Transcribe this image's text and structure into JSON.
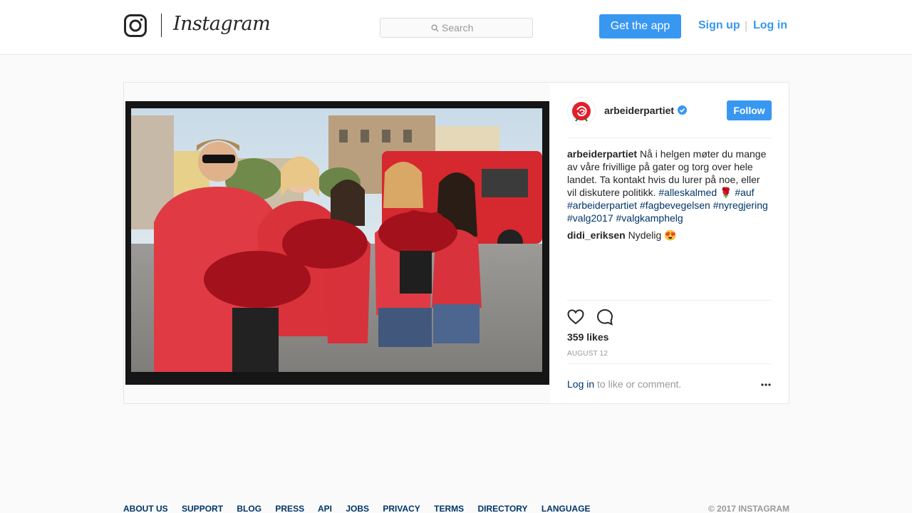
{
  "header": {
    "logo_text": "Instagram",
    "logo_icon": "instagram-camera-icon",
    "search": {
      "placeholder": "Search",
      "icon": "search-icon"
    },
    "get_app_label": "Get the app",
    "signup_label": "Sign up",
    "separator": "|",
    "login_label": "Log in"
  },
  "post": {
    "owner": "arbeiderpartiet",
    "verified_icon": "verified-badge-icon",
    "follow_label": "Follow",
    "caption": {
      "user": "arbeiderpartiet",
      "text": "Nå i helgen møter du mange av våre frivillige på gater og torg over hele landet. Ta kontakt hvis du lurer på noe, eller vil diskutere politikk.",
      "tag1": "#alleskalmed",
      "emoji": "🌹",
      "tags": [
        "#auf",
        "#arbeiderpartiet",
        "#fagbevegelsen",
        "#nyregjering",
        "#valg2017",
        "#valgkamphelg"
      ]
    },
    "comment": {
      "user": "didi_eriksen",
      "text": "Nydelig 😍"
    },
    "likes": "359 likes",
    "date": "AUGUST 12",
    "login_prompt": {
      "link": "Log in",
      "text": " to like or comment."
    }
  },
  "footer": {
    "links": [
      "ABOUT US",
      "SUPPORT",
      "BLOG",
      "PRESS",
      "API",
      "JOBS",
      "PRIVACY",
      "TERMS",
      "DIRECTORY",
      "LANGUAGE"
    ],
    "copyright": "© 2017 INSTAGRAM"
  },
  "colors": {
    "accent": "#3897f0",
    "link": "#003569",
    "muted": "#999999",
    "party_red": "#e0202c"
  }
}
